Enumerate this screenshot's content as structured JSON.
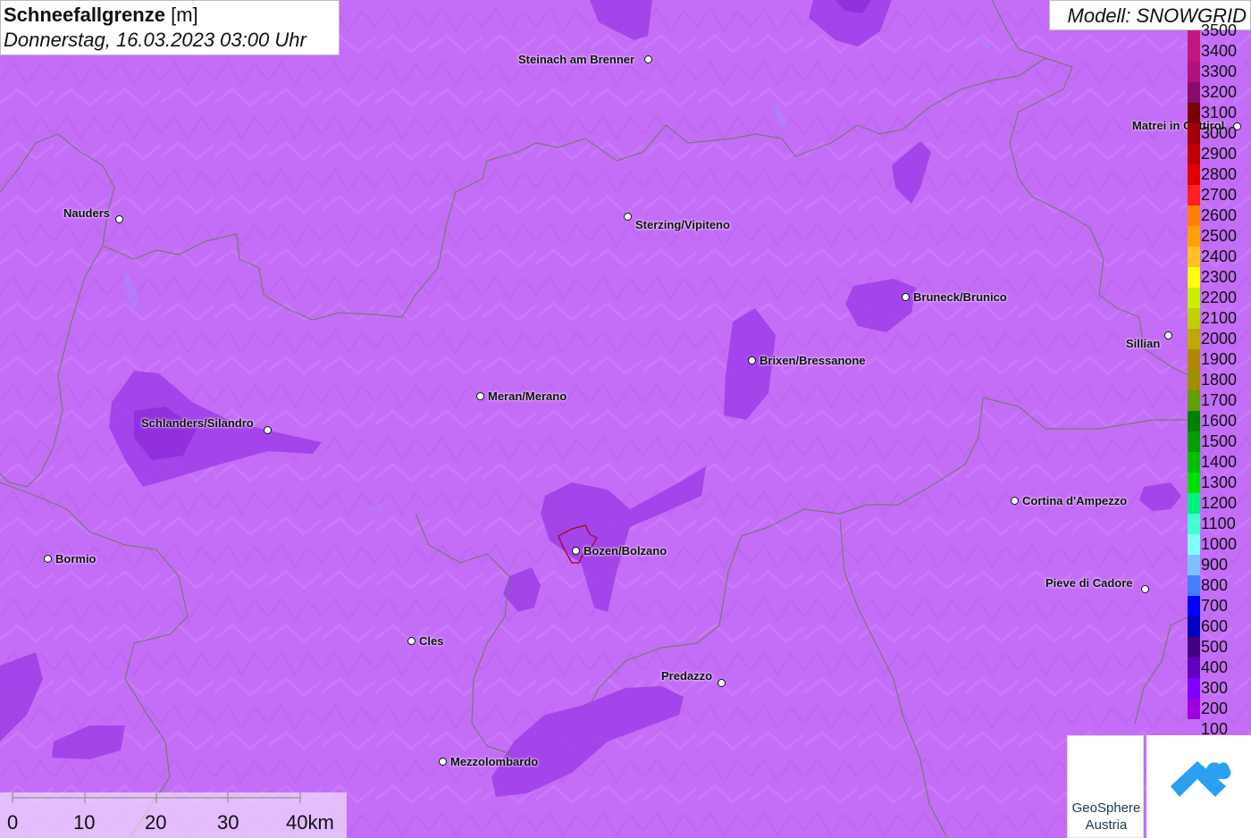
{
  "title": {
    "variable": "Schneefallgrenze",
    "unit": "[m]",
    "datetime": "Donnerstag, 16.03.2023 03:00 Uhr"
  },
  "model": "Modell: SNOWGRID",
  "cities": [
    {
      "name": "Steinach am Brenner"
    },
    {
      "name": "Matrei in Osttirol"
    },
    {
      "name": "Nauders"
    },
    {
      "name": "Sterzing/Vipiteno"
    },
    {
      "name": "Bruneck/Brunico"
    },
    {
      "name": "Sillian"
    },
    {
      "name": "Brixen/Bressanone"
    },
    {
      "name": "Meran/Merano"
    },
    {
      "name": "Schlanders/Silandro"
    },
    {
      "name": "Cortina d'Ampezzo"
    },
    {
      "name": "Bozen/Bolzano"
    },
    {
      "name": "Bormio"
    },
    {
      "name": "Pieve di Cadore"
    },
    {
      "name": "Cles"
    },
    {
      "name": "Predazzo"
    },
    {
      "name": "Mezzolombardo"
    }
  ],
  "legend": {
    "unit": "m",
    "levels": [
      {
        "value": "3500",
        "color": "#c2187e"
      },
      {
        "value": "3400",
        "color": "#c4157a"
      },
      {
        "value": "3300",
        "color": "#b3127a"
      },
      {
        "value": "3200",
        "color": "#8a0a70"
      },
      {
        "value": "3100",
        "color": "#7a0000"
      },
      {
        "value": "3000",
        "color": "#a00000"
      },
      {
        "value": "2900",
        "color": "#c00000"
      },
      {
        "value": "2800",
        "color": "#e00000"
      },
      {
        "value": "2700",
        "color": "#ff2020"
      },
      {
        "value": "2600",
        "color": "#ff8000"
      },
      {
        "value": "2500",
        "color": "#ffa000"
      },
      {
        "value": "2400",
        "color": "#ffc020"
      },
      {
        "value": "2300",
        "color": "#ffff00"
      },
      {
        "value": "2200",
        "color": "#c8f000"
      },
      {
        "value": "2100",
        "color": "#c0d000"
      },
      {
        "value": "2000",
        "color": "#c0a800"
      },
      {
        "value": "1900",
        "color": "#b08800"
      },
      {
        "value": "1800",
        "color": "#a09000"
      },
      {
        "value": "1700",
        "color": "#60a000"
      },
      {
        "value": "1600",
        "color": "#008000"
      },
      {
        "value": "1500",
        "color": "#00a000"
      },
      {
        "value": "1400",
        "color": "#00c000"
      },
      {
        "value": "1300",
        "color": "#00e000"
      },
      {
        "value": "1200",
        "color": "#00f080"
      },
      {
        "value": "1100",
        "color": "#40ffd0"
      },
      {
        "value": "1000",
        "color": "#80ffff"
      },
      {
        "value": "900",
        "color": "#80c0ff"
      },
      {
        "value": "800",
        "color": "#4080ff"
      },
      {
        "value": "700",
        "color": "#0000ff"
      },
      {
        "value": "600",
        "color": "#0000c0"
      },
      {
        "value": "500",
        "color": "#400080"
      },
      {
        "value": "400",
        "color": "#6000c0"
      },
      {
        "value": "300",
        "color": "#8000ff"
      },
      {
        "value": "200",
        "color": "#a000e0"
      },
      {
        "value": "100",
        "color": "#c46ef8"
      }
    ]
  },
  "scale_bar": {
    "labels": [
      "0",
      "10",
      "20",
      "30",
      "40km"
    ]
  },
  "colors": {
    "background": "#c46ef8",
    "patch": "#a040e8",
    "patch_dark": "#8a28d8",
    "border": "#777777",
    "city_outline": "#a01040"
  },
  "logos": {
    "geosphere": [
      "GeoSphere",
      "Austria"
    ]
  }
}
